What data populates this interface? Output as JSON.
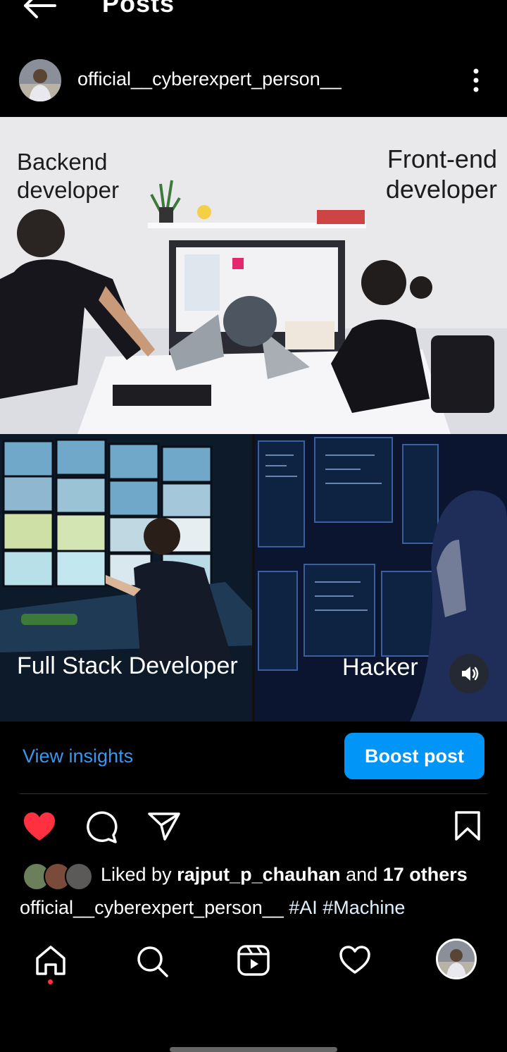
{
  "header": {
    "title": "Posts",
    "back_icon": "arrow-left-icon"
  },
  "post": {
    "username": "official__cyberexpert_person__",
    "more_icon": "more-vertical-icon",
    "image": {
      "panels": [
        {
          "labels": [
            "Backend developer",
            "Front-end developer"
          ]
        },
        {
          "label": "Full Stack Developer"
        },
        {
          "label": "Hacker"
        }
      ],
      "backend_label_line1": "Backend",
      "backend_label_line2": "developer",
      "frontend_label_line1": "Front-end",
      "frontend_label_line2": "developer",
      "fullstack_label": "Full Stack Developer",
      "hacker_label": "Hacker",
      "volume_icon": "volume-icon"
    },
    "view_insights": "View insights",
    "boost_post": "Boost post",
    "actions": {
      "like_icon": "heart-filled-icon",
      "comment_icon": "comment-icon",
      "share_icon": "send-icon",
      "save_icon": "bookmark-icon",
      "liked_color": "#ff3040"
    },
    "likes": {
      "prefix": "Liked by",
      "user": "rajput_p_chauhan",
      "middle": "and",
      "others": "17 others"
    },
    "caption": {
      "username": "official__cyberexpert_person__",
      "tags": "#AI #Machine"
    }
  },
  "bottom_nav": {
    "items": [
      "home-icon",
      "search-icon",
      "reels-icon",
      "activity-heart-icon",
      "profile-avatar"
    ]
  },
  "colors": {
    "background": "#000000",
    "accent": "#0095f6",
    "link": "#3897f0",
    "like": "#ff3040"
  }
}
